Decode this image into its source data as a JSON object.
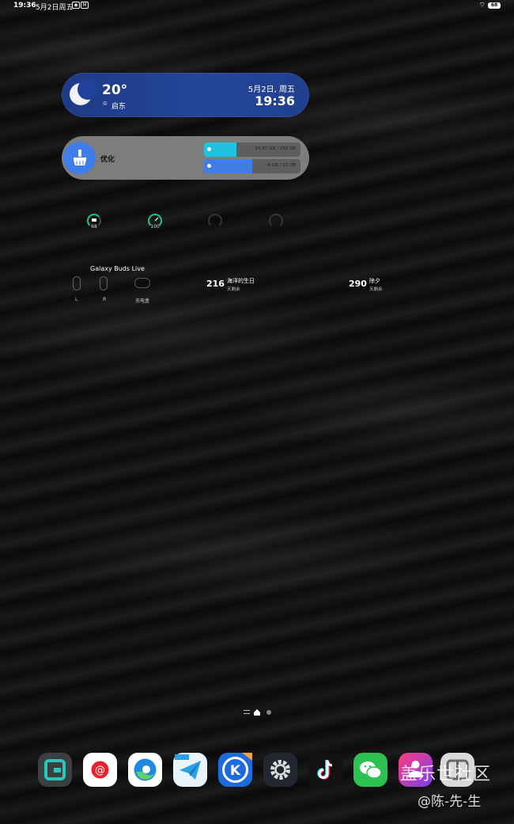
{
  "status_bar": {
    "time": "19:36",
    "date": "5月2日周五",
    "battery": "68"
  },
  "weather": {
    "temperature": "20°",
    "location": "启东",
    "date": "5月2日, 周五",
    "time": "19:36"
  },
  "optimize": {
    "label": "优化",
    "storage": {
      "text": "85.87 GB / 256 GB",
      "fraction": 0.335,
      "color": "#1fc3e0"
    },
    "memory": {
      "text": "6 GB / 12 GB",
      "fraction": 0.5,
      "color": "#3f7ee8"
    }
  },
  "gauges": [
    {
      "label": "68",
      "value": 0.68
    },
    {
      "label": "100",
      "value": 1.0
    },
    {
      "label": "",
      "value": 0
    },
    {
      "label": "",
      "value": 0
    }
  ],
  "buds": {
    "title": "Galaxy Buds Live",
    "left_label": "L",
    "right_label": "R",
    "case_label": "充电盒"
  },
  "countdowns": [
    {
      "days": "216",
      "name": "海洋的生日",
      "sub": "天剩余"
    },
    {
      "days": "290",
      "name": "除夕",
      "sub": "天剩余"
    }
  ],
  "dock": [
    {
      "name": "gallery-app",
      "icon": "gallery-icon"
    },
    {
      "name": "email-app",
      "icon": "at-sign-icon"
    },
    {
      "name": "edge-browser",
      "icon": "edge-icon"
    },
    {
      "name": "telegram-app",
      "icon": "paper-plane-icon"
    },
    {
      "name": "kugou-music",
      "icon": "k-letter-icon"
    },
    {
      "name": "settings-app",
      "icon": "gear-icon"
    },
    {
      "name": "tiktok-app",
      "icon": "tiktok-icon"
    },
    {
      "name": "wechat-app",
      "icon": "wechat-icon"
    },
    {
      "name": "community-app",
      "icon": "people-icon"
    },
    {
      "name": "multitask-app",
      "icon": "window-icon"
    }
  ],
  "watermark": {
    "line1": "盖乐世社区",
    "line2": "@陈-先-生"
  }
}
